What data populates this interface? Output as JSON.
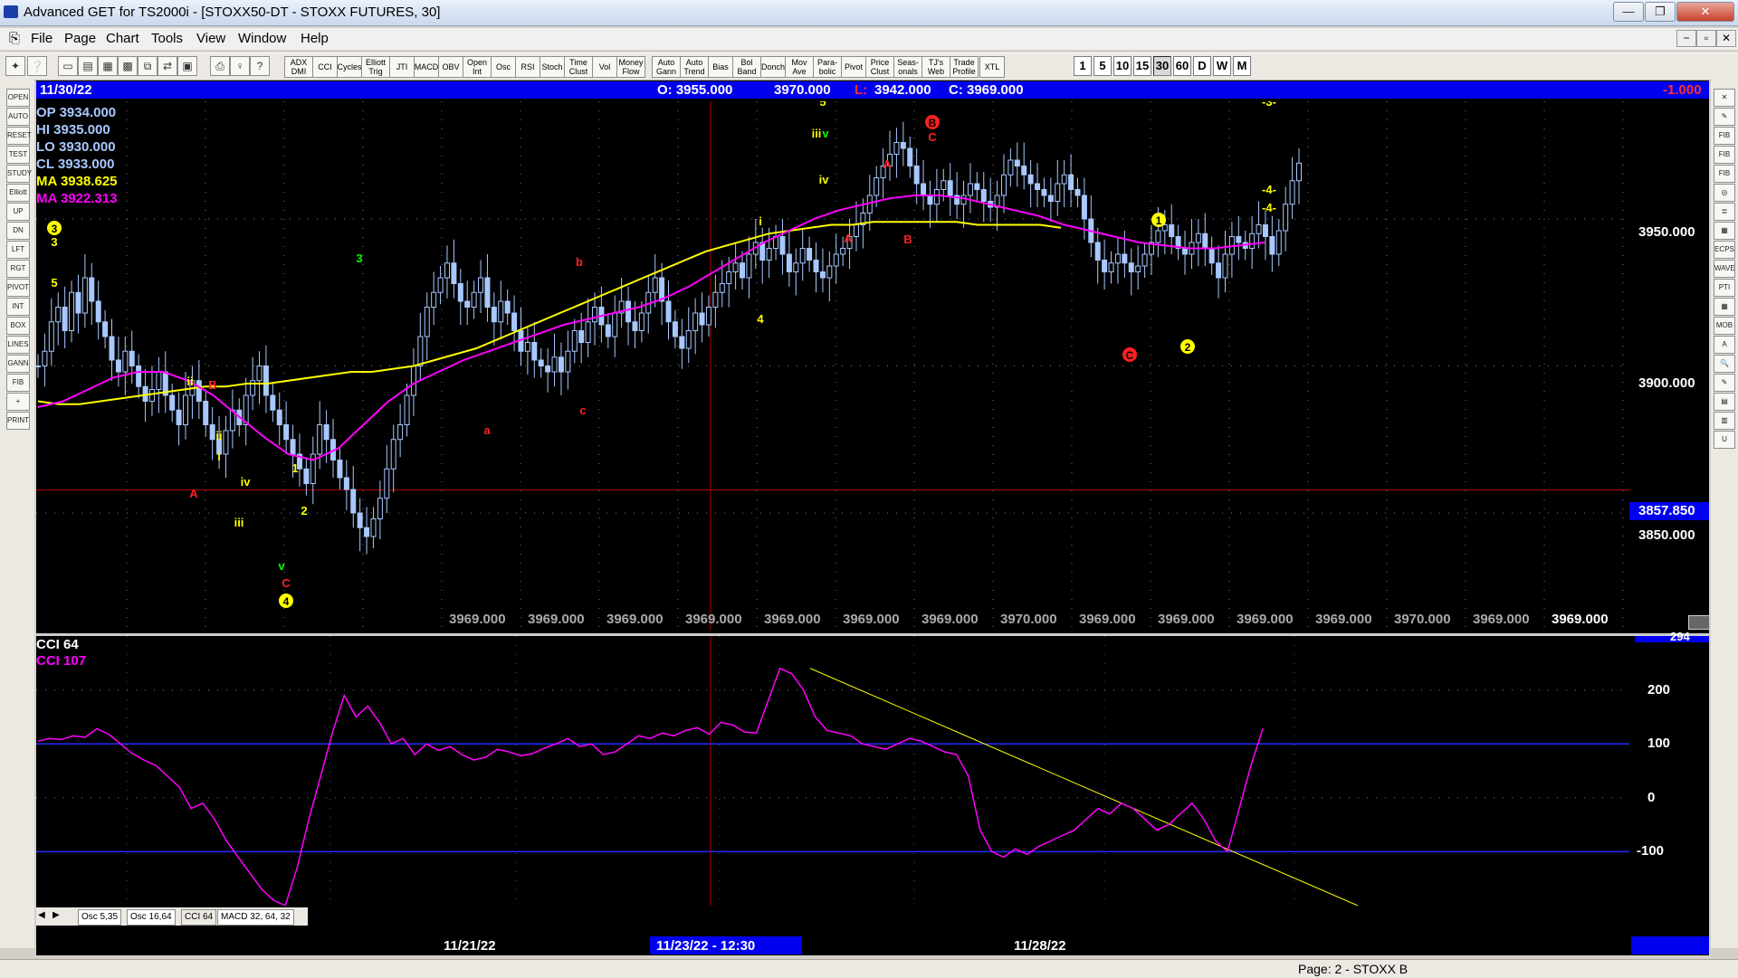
{
  "window": {
    "title": "Advanced GET for TS2000i - [STOXX50-DT - STOXX FUTURES, 30]",
    "minimize": "—",
    "restore": "❐",
    "close": "✕"
  },
  "menu": [
    "File",
    "Page",
    "Chart",
    "Tools",
    "View",
    "Window",
    "Help"
  ],
  "mdi_controls": {
    "min": "−",
    "restore": "▫",
    "close": "✕"
  },
  "toolbar": {
    "tools": [
      "ADX DMI",
      "CCI",
      "Cycles",
      "Elliott Trig",
      "JTI",
      "MACD",
      "OBV",
      "Open Int",
      "Osc",
      "RSI",
      "Stoch",
      "Time Clust",
      "Vol",
      "Money Flow",
      "Auto Gann",
      "Auto Trend",
      "Bias",
      "Bol Band",
      "Donch",
      "Mov Ave",
      "Para-bolic",
      "Pivot",
      "Price Clust",
      "Seas-onals",
      "TJ's Web",
      "Trade Profile",
      "XTL"
    ],
    "timeframes": [
      "1",
      "5",
      "10",
      "15",
      "30",
      "60",
      "D",
      "W",
      "M"
    ],
    "active_timeframe": "30"
  },
  "left_tools": [
    "OPEN",
    "AUTO",
    "RESET",
    "TEST",
    "STUDY",
    "Elliott",
    "UP",
    "DN",
    "LFT",
    "RGT",
    "PIVOT",
    "INT",
    "BOX",
    "LINES",
    "GANN",
    "FIB",
    "+",
    "PRINT"
  ],
  "right_tools": [
    "✕",
    "✎",
    "FIB RET",
    "FIB EXT",
    "FIB TIME",
    "◎",
    "≣",
    "▦",
    "ECPS",
    "WAVE",
    "PTI",
    "▦",
    "MOB",
    "A",
    "🔍",
    "✎",
    "▤",
    "▥",
    "U"
  ],
  "info_bar": {
    "date": "11/30/22",
    "open": "O: 3955.000",
    "high": "3970.000",
    "low_label": "L:",
    "low": "3942.000",
    "close": "C: 3969.000",
    "change": "-1.000"
  },
  "overlay_values": [
    {
      "text": "OP  3934.000",
      "color": "#a8c8ff"
    },
    {
      "text": "HI   3935.000",
      "color": "#a8c8ff"
    },
    {
      "text": "LO  3930.000",
      "color": "#a8c8ff"
    },
    {
      "text": "CL  3933.000",
      "color": "#a8c8ff"
    },
    {
      "text": "MA  3938.625",
      "color": "#ffff00"
    },
    {
      "text": "MA  3922.313",
      "color": "#ff00ff"
    }
  ],
  "price_axis": {
    "labels": [
      "3950.000",
      "3900.000",
      "3850.000"
    ],
    "crosshair_price": "3857.850",
    "ylim": [
      3810,
      3990
    ]
  },
  "bottom_price_labels": [
    "3969.000",
    "3969.000",
    "3969.000",
    "3969.000",
    "3969.000",
    "3969.000",
    "3969.000",
    "3970.000",
    "3969.000",
    "3969.000",
    "3969.000",
    "3969.000",
    "3970.000",
    "3969.000",
    "3969.000"
  ],
  "wave_labels": [
    {
      "text": "5",
      "color": "#ffff00"
    },
    {
      "text": "-3-",
      "color": "#ffff00"
    },
    {
      "text": "B",
      "color": "#ff2020"
    },
    {
      "text": "C",
      "color": "#ff2020"
    },
    {
      "text": "3",
      "color": "#ffff00"
    },
    {
      "text": "iii",
      "color": "#ffff00"
    },
    {
      "text": "v",
      "color": "#00ff00"
    },
    {
      "text": "A",
      "color": "#ff2020"
    },
    {
      "text": "iv",
      "color": "#ffff00"
    },
    {
      "text": "-4-",
      "color": "#ffff00"
    },
    {
      "text": "-4-",
      "color": "#ffff00"
    },
    {
      "text": "3",
      "color": "#ffff00"
    },
    {
      "text": "5",
      "color": "#ffff00"
    },
    {
      "text": "i",
      "color": "#ffff00"
    },
    {
      "text": "A",
      "color": "#ff2020"
    },
    {
      "text": "B",
      "color": "#ff2020"
    },
    {
      "text": "1",
      "color": "#ffff00"
    },
    {
      "text": "3",
      "color": "#00ff00"
    },
    {
      "text": "b",
      "color": "#ff2020"
    },
    {
      "text": "ii",
      "color": "#ffff00"
    },
    {
      "text": "4",
      "color": "#ffff00"
    },
    {
      "text": "C",
      "color": "#ff2020"
    },
    {
      "text": "2",
      "color": "#ffff00"
    },
    {
      "text": "B",
      "color": "#ff2020"
    },
    {
      "text": "ii",
      "color": "#ffff00"
    },
    {
      "text": "c",
      "color": "#ff2020"
    },
    {
      "text": "i",
      "color": "#ffff00"
    },
    {
      "text": "a",
      "color": "#ff2020"
    },
    {
      "text": "A",
      "color": "#ff2020"
    },
    {
      "text": "iv",
      "color": "#ffff00"
    },
    {
      "text": "1",
      "color": "#ffff00"
    },
    {
      "text": "iii",
      "color": "#ffff00"
    },
    {
      "text": "2",
      "color": "#ffff00"
    },
    {
      "text": "v",
      "color": "#00ff00"
    },
    {
      "text": "C",
      "color": "#ff2020"
    },
    {
      "text": "4",
      "color": "#ffff00"
    }
  ],
  "oscillator": {
    "title": "CCI 64",
    "value_label": "CCI  107",
    "top_value": "294",
    "ticks": [
      "200",
      "100",
      "0",
      "-100"
    ],
    "ylim": [
      -200,
      300
    ]
  },
  "osc_tabs": [
    "Osc 5,35",
    "Osc 16,64",
    "CCI 64",
    "MACD 32, 64, 32"
  ],
  "date_axis": {
    "labels": [
      "11/21/22",
      "11/23/22 - 12:30",
      "11/28/22"
    ]
  },
  "status": {
    "page": "Page: 2 - STOXX B"
  },
  "colors": {
    "up_bar": "#a8c8ff",
    "ma_fast": "#ffff00",
    "ma_slow": "#ff00ff",
    "cci": "#ff00ff",
    "axis_band": "#0000ee",
    "crosshair": "#aa0000"
  },
  "chart_data": {
    "type": "candlestick",
    "price_axis_ticks": [
      3950,
      3900,
      3850
    ],
    "crosshair": {
      "price": 3857.85,
      "time": "11/23/22 - 12:30"
    },
    "bars_close": [
      3900,
      3905,
      3915,
      3920,
      3912,
      3925,
      3918,
      3930,
      3922,
      3915,
      3910,
      3902,
      3898,
      3905,
      3900,
      3893,
      3888,
      3892,
      3898,
      3890,
      3885,
      3880,
      3890,
      3895,
      3888,
      3880,
      3875,
      3870,
      3878,
      3885,
      3880,
      3890,
      3895,
      3900,
      3890,
      3885,
      3880,
      3875,
      3870,
      3865,
      3860,
      3870,
      3880,
      3875,
      3868,
      3862,
      3858,
      3850,
      3845,
      3842,
      3848,
      3855,
      3865,
      3875,
      3880,
      3890,
      3900,
      3910,
      3920,
      3925,
      3930,
      3935,
      3928,
      3922,
      3920,
      3925,
      3930,
      3920,
      3915,
      3922,
      3918,
      3912,
      3905,
      3908,
      3902,
      3900,
      3898,
      3903,
      3898,
      3905,
      3912,
      3908,
      3915,
      3920,
      3914,
      3910,
      3918,
      3922,
      3915,
      3912,
      3918,
      3925,
      3930,
      3922,
      3915,
      3910,
      3906,
      3912,
      3918,
      3914,
      3920,
      3925,
      3928,
      3932,
      3935,
      3930,
      3938,
      3942,
      3936,
      3940,
      3944,
      3938,
      3932,
      3935,
      3940,
      3936,
      3932,
      3930,
      3934,
      3938,
      3940,
      3944,
      3948,
      3952,
      3958,
      3964,
      3968,
      3972,
      3976,
      3974,
      3968,
      3962,
      3958,
      3955,
      3960,
      3963,
      3958,
      3955,
      3958,
      3962,
      3960,
      3956,
      3954,
      3958,
      3965,
      3970,
      3968,
      3965,
      3962,
      3960,
      3958,
      3956,
      3962,
      3965,
      3960,
      3958,
      3950,
      3942,
      3936,
      3932,
      3935,
      3938,
      3935,
      3932,
      3934,
      3938,
      3942,
      3946,
      3948,
      3944,
      3940,
      3938,
      3942,
      3945,
      3940,
      3935,
      3930,
      3938,
      3944,
      3942,
      3940,
      3945,
      3948,
      3944,
      3938,
      3946,
      3955,
      3963,
      3969
    ],
    "ma_fast": [
      3888,
      3887,
      3887,
      3888,
      3889,
      3890,
      3891,
      3892,
      3893,
      3893,
      3894,
      3894,
      3895,
      3896,
      3897,
      3898,
      3898,
      3899,
      3900,
      3902,
      3904,
      3906,
      3909,
      3912,
      3915,
      3918,
      3921,
      3924,
      3927,
      3930,
      3933,
      3936,
      3939,
      3941,
      3943,
      3945,
      3946,
      3947,
      3948,
      3948,
      3949,
      3949,
      3949,
      3949,
      3949,
      3948,
      3948,
      3948,
      3948,
      3947
    ],
    "ma_slow": [
      3886,
      3888,
      3892,
      3896,
      3898,
      3898,
      3895,
      3890,
      3883,
      3876,
      3870,
      3868,
      3872,
      3880,
      3888,
      3894,
      3898,
      3902,
      3905,
      3908,
      3911,
      3914,
      3916,
      3918,
      3920,
      3923,
      3927,
      3932,
      3937,
      3942,
      3946,
      3950,
      3953,
      3955,
      3957,
      3958,
      3958,
      3957,
      3955,
      3953,
      3951,
      3948,
      3946,
      3944,
      3942,
      3941,
      3940,
      3940,
      3941,
      3942
    ],
    "cci": [
      105,
      110,
      108,
      115,
      112,
      128,
      118,
      100,
      82,
      70,
      60,
      40,
      20,
      -20,
      -10,
      -40,
      -80,
      -110,
      -140,
      -170,
      -190,
      -200,
      -130,
      -40,
      40,
      120,
      190,
      150,
      170,
      140,
      100,
      110,
      80,
      100,
      88,
      95,
      80,
      70,
      75,
      90,
      85,
      78,
      82,
      92,
      100,
      110,
      95,
      100,
      80,
      85,
      100,
      115,
      110,
      120,
      115,
      125,
      130,
      118,
      140,
      135,
      122,
      120,
      180,
      240,
      230,
      200,
      150,
      125,
      120,
      115,
      100,
      95,
      90,
      100,
      110,
      105,
      95,
      85,
      80,
      40,
      -60,
      -100,
      -110,
      -95,
      -105,
      -90,
      -80,
      -70,
      -60,
      -40,
      -20,
      -30,
      -10,
      -20,
      -40,
      -60,
      -50,
      -30,
      -10,
      -40,
      -80,
      -100,
      -20,
      60,
      128
    ]
  }
}
